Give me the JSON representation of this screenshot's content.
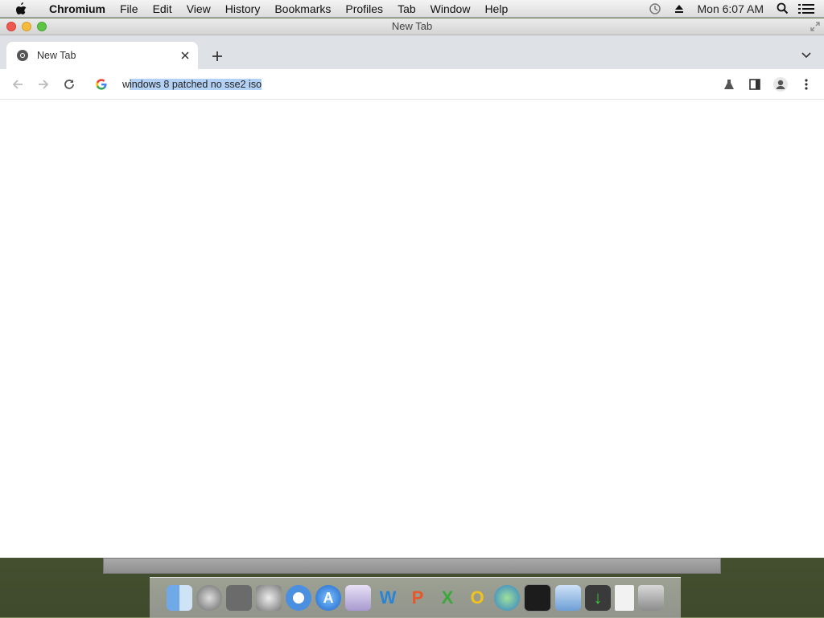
{
  "menubar": {
    "app_name": "Chromium",
    "items": [
      "File",
      "Edit",
      "View",
      "History",
      "Bookmarks",
      "Profiles",
      "Tab",
      "Window",
      "Help"
    ],
    "clock": "Mon 6:07 AM"
  },
  "window": {
    "title": "New Tab"
  },
  "tabs": [
    {
      "title": "New Tab",
      "active": true
    }
  ],
  "omnibox": {
    "text_unselected": "w",
    "text_selected": "indows 8 patched no sse2 iso"
  },
  "dock": {
    "icons": [
      "finder-icon",
      "launchpad-icon",
      "image-capture-icon",
      "system-preferences-icon",
      "chromium-icon",
      "app-store-icon",
      "wizard-icon",
      "word-icon",
      "powerpoint-icon",
      "excel-icon",
      "outlook-icon",
      "network-globe-icon",
      "terminal-icon",
      "virtualbox-icon",
      "downloads-icon",
      "document-icon",
      "trash-icon"
    ]
  },
  "colors": {
    "tab_strip": "#dee1e6",
    "selection": "#b3d1f5",
    "close": "#ee5a52",
    "minimize": "#f5bb3a",
    "zoom": "#5fc446"
  }
}
